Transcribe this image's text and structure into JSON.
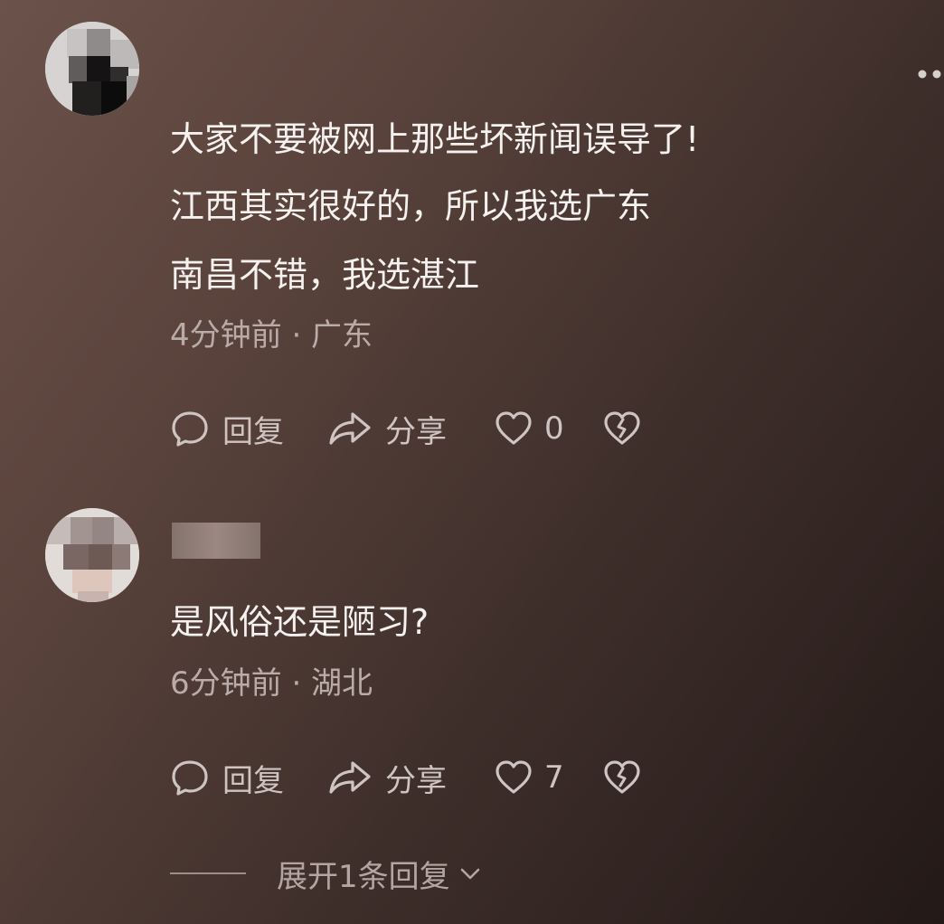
{
  "comments": [
    {
      "lines": [
        "大家不要被网上那些坏新闻误导了!",
        "江西其实很好的，所以我选广东",
        "南昌不错，我选湛江"
      ],
      "meta": "4分钟前 · 广东",
      "actions": {
        "reply": "回复",
        "share": "分享",
        "likes": "0"
      }
    },
    {
      "lines": [
        "是风俗还是陋习?"
      ],
      "meta": "6分钟前 · 湖北",
      "actions": {
        "reply": "回复",
        "share": "分享",
        "likes": "7"
      }
    }
  ],
  "expand_replies": "展开1条回复",
  "icons": {
    "reply": "speech-bubble-icon",
    "share": "share-arrow-icon",
    "like": "heart-icon",
    "dislike": "broken-heart-icon",
    "more": "more-dots-icon",
    "expand": "chevron-down-icon"
  },
  "colors": {
    "text": "#f4f1ef",
    "meta": "#b9aca8",
    "action": "#cec4c1"
  }
}
